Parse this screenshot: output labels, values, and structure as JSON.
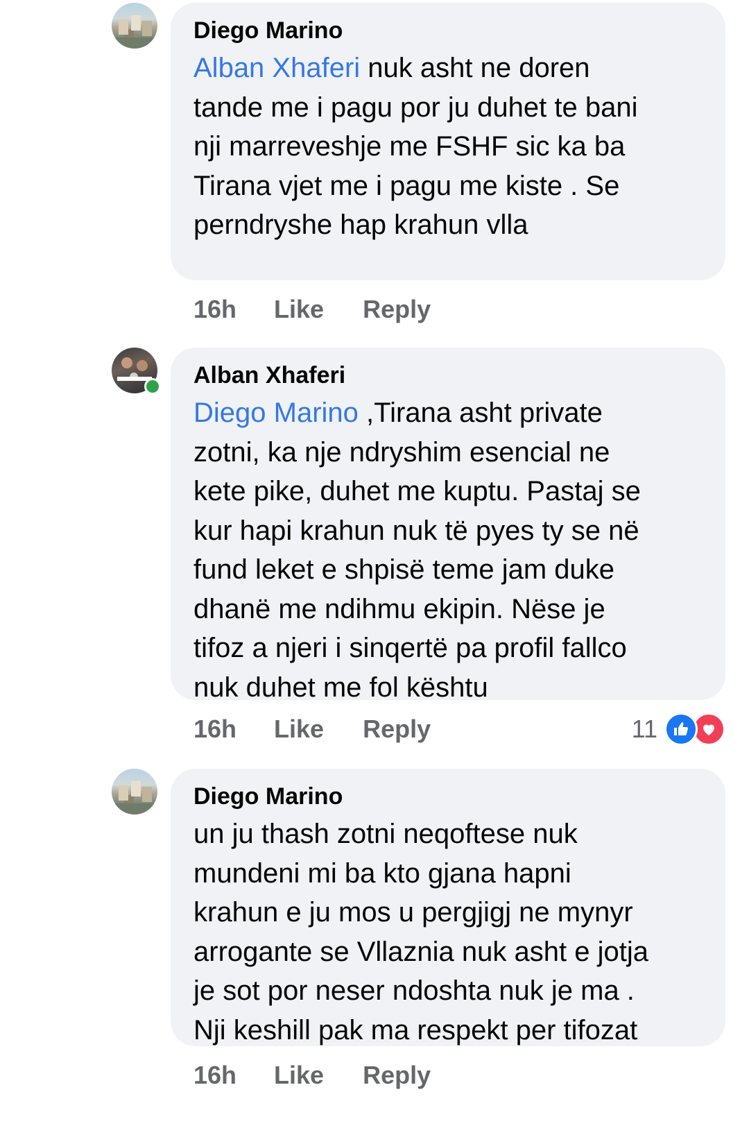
{
  "comments": [
    {
      "author": "Diego Marino",
      "mention": "Alban Xhaferi",
      "text_lines": [
        "nuk asht ne doren",
        "tande me i pagu por ju duhet te bani",
        "nji marreveshje me FSHF sic ka ba",
        "Tirana vjet me i pagu me kiste . Se",
        "perndryshe hap krahun vlla"
      ],
      "time": "16h",
      "like": "Like",
      "reply": "Reply",
      "avatar": "city-avatar"
    },
    {
      "author": "Alban Xhaferi",
      "mention": "Diego Marino",
      "text_lines": [
        ",Tirana asht private",
        "zotni, ka nje ndryshim esencial ne",
        "kete pike, duhet me kuptu. Pastaj se",
        "kur hapi krahun nuk të pyes ty se në",
        "fund leket e shpisë teme jam duke",
        "dhanë me ndihmu ekipin. Nëse je",
        "tifoz a njeri i sinqertë pa profil fallco",
        "nuk duhet me fol kështu"
      ],
      "time": "16h",
      "like": "Like",
      "reply": "Reply",
      "reactions": {
        "count": "11",
        "icons": [
          "like-reaction-icon",
          "love-reaction-icon"
        ]
      },
      "avatar": "group-photo-avatar",
      "online": true
    },
    {
      "author": "Diego Marino",
      "text_lines": [
        "un ju thash zotni neqoftese nuk",
        "mundeni mi ba kto gjana hapni",
        "krahun e ju mos u pergjigj ne mynyr",
        "arrogante se Vllaznia nuk asht e jotja",
        "je sot por neser ndoshta nuk je ma .",
        "Nji keshill pak ma respekt per tifozat"
      ],
      "time": "16h",
      "like": "Like",
      "reply": "Reply",
      "avatar": "city-avatar"
    }
  ],
  "colors": {
    "mention": "#3578e5",
    "bubble": "#f0f2f5",
    "meta": "#65676b",
    "online": "#31a24c"
  }
}
